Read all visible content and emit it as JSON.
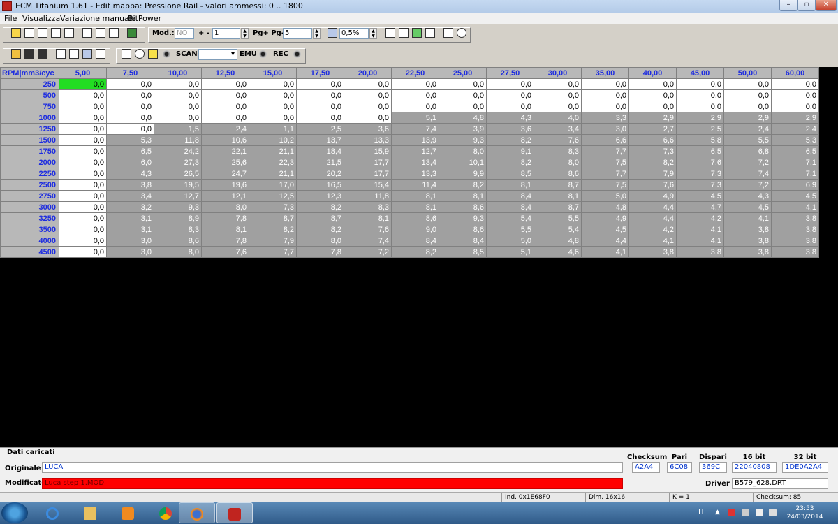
{
  "window": {
    "title": "ECM Titanium 1.61 - Edit mappa: Pressione Rail - valori ammessi: 0 .. 1800",
    "min_label": "–",
    "max_label": "▫",
    "close_label": "✕"
  },
  "menu": [
    "File",
    "Visualizza",
    "Variazione manuale",
    "BitPower"
  ],
  "toolbar1": {
    "mod_label": "Mod.:",
    "mod_value": "NO",
    "plusminus_label": "+ -",
    "plusminus_value": "1",
    "pg_label": "Pg+ Pg-",
    "pg_value": "5",
    "percent_value": "0,5%"
  },
  "toolbar2": {
    "scan_label": "SCAN",
    "emu_label": "EMU",
    "rec_label": "REC"
  },
  "map": {
    "corner": "RPM|mm3/cyc",
    "columns": [
      "5,00",
      "7,50",
      "10,00",
      "12,50",
      "15,00",
      "17,50",
      "20,00",
      "22,50",
      "25,00",
      "27,50",
      "30,00",
      "35,00",
      "40,00",
      "45,00",
      "50,00",
      "60,00"
    ],
    "rows": [
      {
        "rpm": "250",
        "v": [
          "0,0",
          "0,0",
          "0,0",
          "0,0",
          "0,0",
          "0,0",
          "0,0",
          "0,0",
          "0,0",
          "0,0",
          "0,0",
          "0,0",
          "0,0",
          "0,0",
          "0,0",
          "0,0"
        ]
      },
      {
        "rpm": "500",
        "v": [
          "0,0",
          "0,0",
          "0,0",
          "0,0",
          "0,0",
          "0,0",
          "0,0",
          "0,0",
          "0,0",
          "0,0",
          "0,0",
          "0,0",
          "0,0",
          "0,0",
          "0,0",
          "0,0"
        ]
      },
      {
        "rpm": "750",
        "v": [
          "0,0",
          "0,0",
          "0,0",
          "0,0",
          "0,0",
          "0,0",
          "0,0",
          "0,0",
          "0,0",
          "0,0",
          "0,0",
          "0,0",
          "0,0",
          "0,0",
          "0,0",
          "0,0"
        ]
      },
      {
        "rpm": "1000",
        "v": [
          "0,0",
          "0,0",
          "0,0",
          "0,0",
          "0,0",
          "0,0",
          "0,0",
          "5,1",
          "4,8",
          "4,3",
          "4,0",
          "3,3",
          "2,9",
          "2,9",
          "2,9",
          "2,9"
        ]
      },
      {
        "rpm": "1250",
        "v": [
          "0,0",
          "0,0",
          "1,5",
          "2,4",
          "1,1",
          "2,5",
          "3,6",
          "7,4",
          "3,9",
          "3,6",
          "3,4",
          "3,0",
          "2,7",
          "2,5",
          "2,4",
          "2,4"
        ]
      },
      {
        "rpm": "1500",
        "v": [
          "0,0",
          "5,3",
          "11,8",
          "10,6",
          "10,2",
          "13,7",
          "13,3",
          "13,9",
          "9,3",
          "8,2",
          "7,6",
          "6,6",
          "6,6",
          "5,8",
          "5,5",
          "5,3"
        ]
      },
      {
        "rpm": "1750",
        "v": [
          "0,0",
          "6,5",
          "24,2",
          "22,1",
          "21,1",
          "18,4",
          "15,9",
          "12,7",
          "8,0",
          "9,1",
          "8,3",
          "7,7",
          "7,3",
          "6,5",
          "6,8",
          "6,5"
        ]
      },
      {
        "rpm": "2000",
        "v": [
          "0,0",
          "6,0",
          "27,3",
          "25,6",
          "22,3",
          "21,5",
          "17,7",
          "13,4",
          "10,1",
          "8,2",
          "8,0",
          "7,5",
          "8,2",
          "7,6",
          "7,2",
          "7,1"
        ]
      },
      {
        "rpm": "2250",
        "v": [
          "0,0",
          "4,3",
          "26,5",
          "24,7",
          "21,1",
          "20,2",
          "17,7",
          "13,3",
          "9,9",
          "8,5",
          "8,6",
          "7,7",
          "7,9",
          "7,3",
          "7,4",
          "7,1"
        ]
      },
      {
        "rpm": "2500",
        "v": [
          "0,0",
          "3,8",
          "19,5",
          "19,6",
          "17,0",
          "16,5",
          "15,4",
          "11,4",
          "8,2",
          "8,1",
          "8,7",
          "7,5",
          "7,6",
          "7,3",
          "7,2",
          "6,9"
        ]
      },
      {
        "rpm": "2750",
        "v": [
          "0,0",
          "3,4",
          "12,7",
          "12,1",
          "12,5",
          "12,3",
          "11,8",
          "8,1",
          "8,1",
          "8,4",
          "8,1",
          "5,0",
          "4,9",
          "4,5",
          "4,3",
          "4,5"
        ]
      },
      {
        "rpm": "3000",
        "v": [
          "0,0",
          "3,2",
          "9,3",
          "8,0",
          "7,3",
          "8,2",
          "8,3",
          "8,1",
          "8,6",
          "8,4",
          "8,7",
          "4,8",
          "4,4",
          "4,7",
          "4,5",
          "4,1"
        ]
      },
      {
        "rpm": "3250",
        "v": [
          "0,0",
          "3,1",
          "8,9",
          "7,8",
          "8,7",
          "8,7",
          "8,1",
          "8,6",
          "9,3",
          "5,4",
          "5,5",
          "4,9",
          "4,4",
          "4,2",
          "4,1",
          "3,8"
        ]
      },
      {
        "rpm": "3500",
        "v": [
          "0,0",
          "3,1",
          "8,3",
          "8,1",
          "8,2",
          "8,2",
          "7,6",
          "9,0",
          "8,6",
          "5,5",
          "5,4",
          "4,5",
          "4,2",
          "4,1",
          "3,8",
          "3,8"
        ]
      },
      {
        "rpm": "4000",
        "v": [
          "0,0",
          "3,0",
          "8,6",
          "7,8",
          "7,9",
          "8,0",
          "7,4",
          "8,4",
          "8,4",
          "5,0",
          "4,8",
          "4,4",
          "4,1",
          "4,1",
          "3,8",
          "3,8"
        ]
      },
      {
        "rpm": "4500",
        "v": [
          "0,0",
          "3,0",
          "8,0",
          "7,6",
          "7,7",
          "7,8",
          "7,2",
          "8,2",
          "8,5",
          "5,1",
          "4,6",
          "4,1",
          "3,8",
          "3,8",
          "3,8",
          "3,8"
        ]
      }
    ]
  },
  "info": {
    "section_title": "Dati caricati",
    "originale_label": "Originale",
    "originale_value": "LUCA",
    "modificato_label": "Modificato",
    "modificato_value": "Luca step 1.MOD",
    "checksum_head": "Checksum",
    "pari_head": "Pari",
    "dispari_head": "Dispari",
    "bit16_head": "16 bit",
    "bit32_head": "32 bit",
    "checksum_value": "A2A4",
    "pari_value": "6C08",
    "dispari_value": "369C",
    "bit16_value": "22040808",
    "bit32_value": "1DE0A2A4",
    "driver_label": "Driver",
    "driver_value": "B579_628.DRT"
  },
  "status": {
    "ind": "Ind. 0x1E68F0",
    "dim": "Dim. 16x16",
    "k": "K = 1",
    "checksum": "Checksum: 85"
  },
  "taskbar": {
    "lang": "IT",
    "time": "23:53",
    "date": "24/03/2014"
  },
  "colors": {
    "selected_cell": "#22dd22",
    "modified_cell": "#a0a0a0",
    "header_text": "#1d2ce0",
    "modificato_bar": "#ff0000"
  }
}
